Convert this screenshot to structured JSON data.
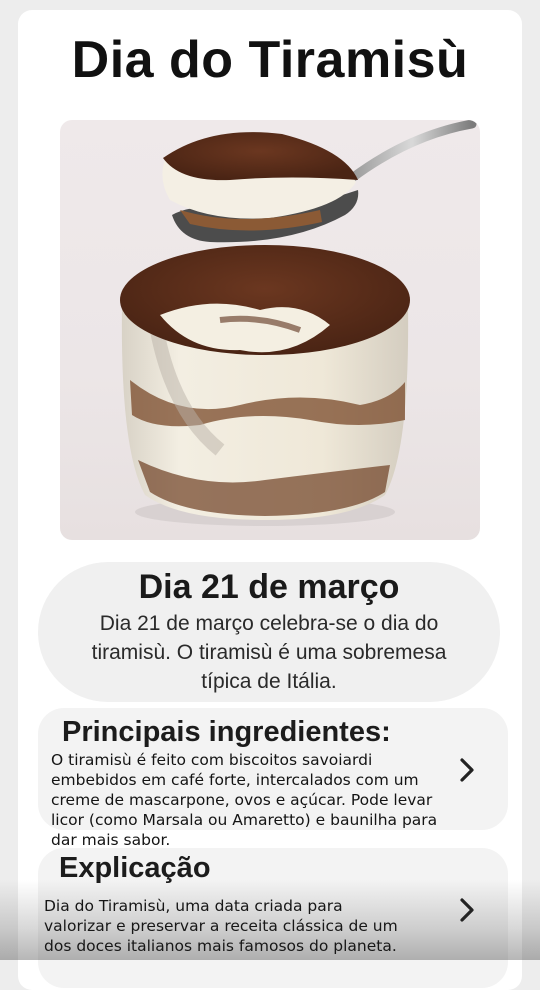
{
  "header": {
    "title": "Dia do Tiramisù"
  },
  "hero": {
    "image_alt": "tiramisu-in-glass-with-spoon"
  },
  "date_card": {
    "heading": "Dia 21 de março",
    "text": "Dia 21 de março celebra-se o dia do tiramisù. O tiramisù é uma sobremesa típica de Itália."
  },
  "ingredients_card": {
    "heading": "Principais ingredientes:",
    "text": "O tiramisù é feito com biscoitos savoiardi embebidos em café forte, intercalados com um creme de mascarpone, ovos e açúcar. Pode levar licor (como Marsala ou Amaretto) e baunilha para dar mais sabor.",
    "chevron_icon": "chevron-right-icon"
  },
  "explanation_card": {
    "heading": "Explicação",
    "text": "Dia do Tiramisù, uma data criada para valorizar e preservar a receita clássica de um dos doces italianos mais famosos do planeta.",
    "chevron_icon": "chevron-right-icon"
  },
  "colors": {
    "background": "#ededed",
    "card": "#f0f0f0",
    "text": "#111111",
    "cocoa": "#5a2e1a"
  }
}
